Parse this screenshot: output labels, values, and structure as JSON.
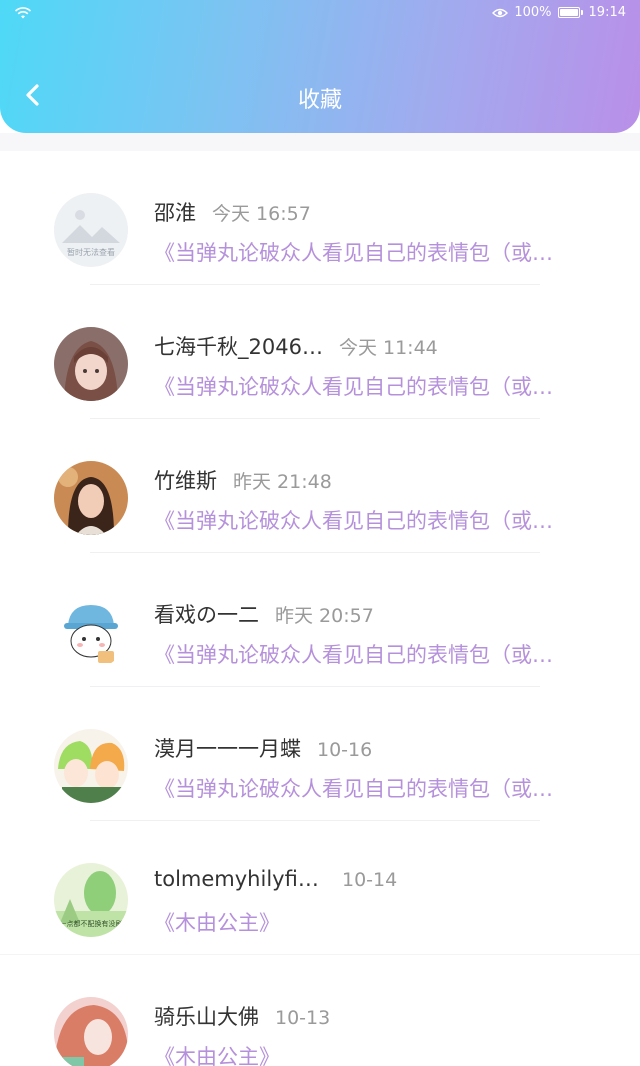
{
  "status": {
    "battery_pct": "100%",
    "clock": "19:14"
  },
  "header": {
    "title": "收藏"
  },
  "items": [
    {
      "name": "邵淮",
      "time": "今天 16:57",
      "title": "《当弹丸论破众人看见自己的表情包（或…",
      "avatar_icon": "placeholder-image-icon",
      "avatar_caption": "暂时无法查看"
    },
    {
      "name": "七海千秋_2046…",
      "time": "今天 11:44",
      "title": "《当弹丸论破众人看见自己的表情包（或…",
      "avatar_icon": "anime-girl-avatar"
    },
    {
      "name": "竹维斯",
      "time": "昨天 21:48",
      "title": "《当弹丸论破众人看见自己的表情包（或…",
      "avatar_icon": "portrait-avatar"
    },
    {
      "name": "看戏の一二",
      "time": "昨天 20:57",
      "title": "《当弹丸论破众人看见自己的表情包（或…",
      "avatar_icon": "cartoon-bear-avatar"
    },
    {
      "name": "漠月一一一月蝶",
      "time": "10-16",
      "title": "《当弹丸论破众人看见自己的表情包（或…",
      "avatar_icon": "anime-duo-avatar"
    },
    {
      "name": "tolmemyhilyfip…",
      "time": "10-14",
      "title": "《木由公主》",
      "avatar_icon": "green-scene-avatar",
      "avatar_caption": "一点都不配换有没刷"
    },
    {
      "name": "骑乐山大佛",
      "time": "10-13",
      "title": "《木由公主》",
      "avatar_icon": "pink-portrait-avatar"
    }
  ]
}
